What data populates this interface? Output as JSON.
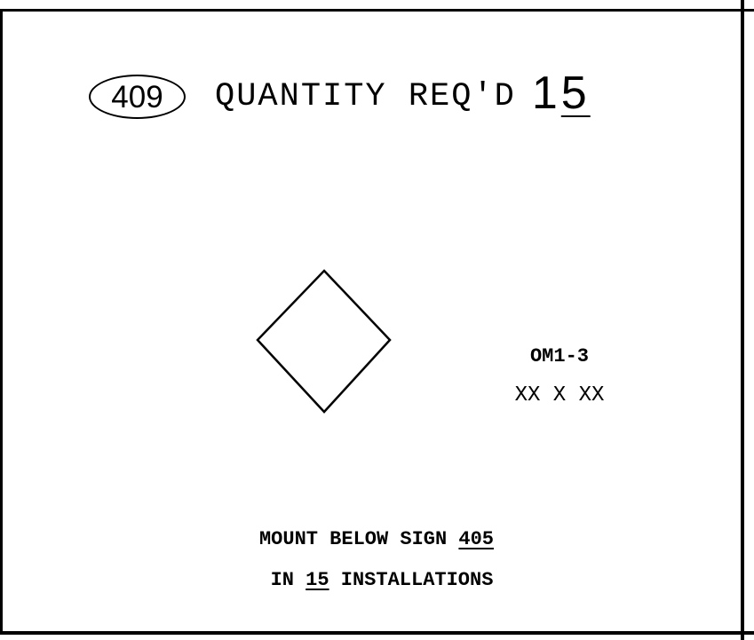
{
  "item_number": "409",
  "quantity": {
    "label": "QUANTITY REQ'D",
    "first_digit": "1",
    "second_digit": "5"
  },
  "sign": {
    "shape": "diamond",
    "code": "OM1-3",
    "size": "XX X XX"
  },
  "note": {
    "line1_prefix": "MOUNT BELOW SIGN ",
    "line1_sign_ref": "405",
    "line2_prefix": "IN ",
    "line2_count": "15",
    "line2_suffix": " INSTALLATIONS"
  },
  "colors": {
    "ink": "#000000",
    "paper": "#ffffff"
  }
}
